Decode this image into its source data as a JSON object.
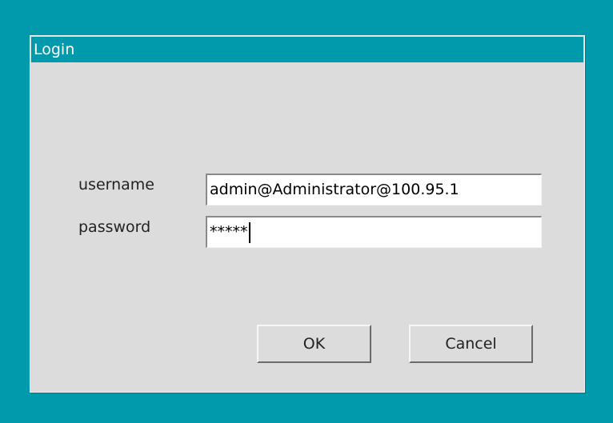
{
  "dialog": {
    "title": "Login",
    "username_label": "username",
    "password_label": "password",
    "username_value": "admin@Administrator@100.95.1",
    "password_value": "*****",
    "ok_label": "OK",
    "cancel_label": "Cancel"
  },
  "colors": {
    "desktop": "#009aac",
    "titlebar": "#009aac",
    "dialog_bg": "#dcdcdc"
  }
}
